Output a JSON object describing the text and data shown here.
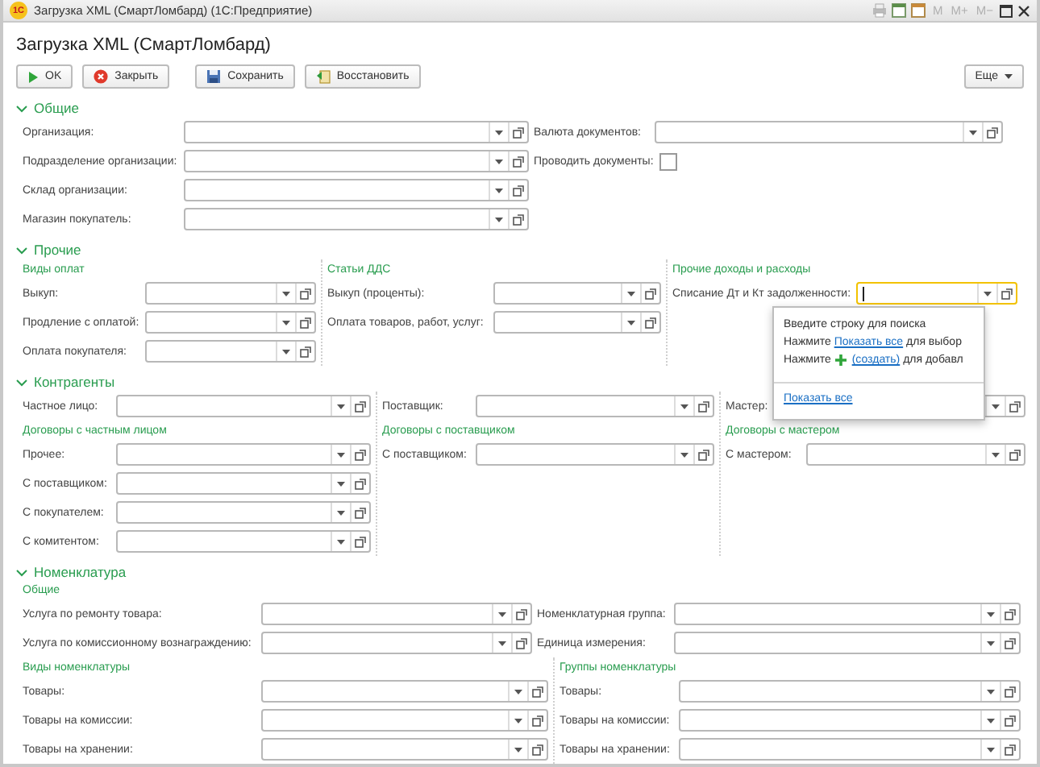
{
  "window": {
    "app_badge": "1С",
    "title": "Загрузка XML (СмартЛомбард)  (1С:Предприятие)",
    "memory_buttons": [
      "M",
      "M+",
      "M−"
    ]
  },
  "form_title": "Загрузка XML (СмартЛомбард)",
  "toolbar": {
    "buttons": [
      {
        "kind": "ok",
        "label": "OK"
      },
      {
        "kind": "close",
        "label": "Закрыть"
      },
      {
        "kind": "save",
        "label": "Сохранить"
      },
      {
        "kind": "restore",
        "label": "Восстановить"
      }
    ],
    "more": "Еще"
  },
  "sections": [
    {
      "title": "Общие",
      "expanded": true,
      "blocks": [
        {
          "columns": [
            {
              "items": [
                {
                  "kind": "select",
                  "label": "Организация:",
                  "focused": false
                },
                {
                  "kind": "select",
                  "label": "Подразделение организации:",
                  "focused": false
                },
                {
                  "kind": "select",
                  "label": "Склад организации:",
                  "focused": false
                },
                {
                  "kind": "select",
                  "label": "Магазин покупатель:",
                  "focused": false
                }
              ]
            },
            {
              "items": [
                {
                  "kind": "select",
                  "label": "Валюта документов:",
                  "focused": false
                },
                {
                  "kind": "checkbox",
                  "label": "Проводить документы:",
                  "checked": false
                }
              ]
            }
          ]
        }
      ]
    },
    {
      "title": "Прочие",
      "expanded": true,
      "blocks": [
        {
          "columns": [
            {
              "items": [
                {
                  "kind": "heading",
                  "text": "Виды оплат"
                },
                {
                  "kind": "select",
                  "label": "Выкуп:",
                  "focused": false
                },
                {
                  "kind": "select",
                  "label": "Продление с оплатой:",
                  "focused": false
                },
                {
                  "kind": "select",
                  "label": "Оплата покупателя:",
                  "focused": false
                }
              ]
            },
            {
              "items": [
                {
                  "kind": "heading",
                  "text": "Статьи ДДС"
                },
                {
                  "kind": "select",
                  "label": "Выкуп (проценты):",
                  "focused": false
                },
                {
                  "kind": "select",
                  "label": "Оплата товаров, работ, услуг:",
                  "focused": false
                }
              ]
            },
            {
              "items": [
                {
                  "kind": "heading",
                  "text": "Прочие доходы и расходы"
                },
                {
                  "kind": "select",
                  "label": "Списание Дт и Кт задолженности:",
                  "focused": true
                }
              ]
            }
          ]
        }
      ]
    },
    {
      "title": "Контрагенты",
      "expanded": true,
      "blocks": [
        {
          "columns": [
            {
              "items": [
                {
                  "kind": "select",
                  "label": "Частное лицо:",
                  "focused": false
                },
                {
                  "kind": "heading",
                  "text": "Договоры с частным лицом"
                },
                {
                  "kind": "select",
                  "label": "Прочее:",
                  "focused": false
                },
                {
                  "kind": "select",
                  "label": "С поставщиком:",
                  "focused": false
                },
                {
                  "kind": "select",
                  "label": "С покупателем:",
                  "focused": false
                },
                {
                  "kind": "select",
                  "label": "С комитентом:",
                  "focused": false
                }
              ]
            },
            {
              "items": [
                {
                  "kind": "select",
                  "label": "Поставщик:",
                  "focused": false
                },
                {
                  "kind": "heading",
                  "text": "Договоры с поставщиком"
                },
                {
                  "kind": "select",
                  "label": "С поставщиком:",
                  "focused": false
                }
              ]
            },
            {
              "items": [
                {
                  "kind": "select",
                  "label": "Мастер:",
                  "focused": false
                },
                {
                  "kind": "heading",
                  "text": "Договоры с мастером"
                },
                {
                  "kind": "select",
                  "label": "С мастером:",
                  "focused": false
                }
              ]
            }
          ]
        }
      ]
    },
    {
      "title": "Номенклатура",
      "expanded": true,
      "blocks": [
        {
          "heading": "Общие",
          "columns": [
            {
              "items": [
                {
                  "kind": "select",
                  "label": "Услуга по ремонту товара:",
                  "focused": false
                },
                {
                  "kind": "select",
                  "label": "Услуга по комиссионному вознаграждению:",
                  "focused": false
                }
              ]
            },
            {
              "items": [
                {
                  "kind": "select",
                  "label": "Номенклатурная группа:",
                  "focused": false
                },
                {
                  "kind": "select",
                  "label": "Единица измерения:",
                  "focused": false
                }
              ]
            }
          ]
        },
        {
          "columns": [
            {
              "items": [
                {
                  "kind": "heading",
                  "text": "Виды номенклатуры"
                },
                {
                  "kind": "select",
                  "label": "Товары:",
                  "focused": false
                },
                {
                  "kind": "select",
                  "label": "Товары на комиссии:",
                  "focused": false
                },
                {
                  "kind": "select",
                  "label": "Товары на хранении:",
                  "focused": false
                }
              ]
            },
            {
              "items": [
                {
                  "kind": "heading",
                  "text": "Группы номенклатуры"
                },
                {
                  "kind": "select",
                  "label": "Товары:",
                  "focused": false
                },
                {
                  "kind": "select",
                  "label": "Товары на комиссии:",
                  "focused": false
                },
                {
                  "kind": "select",
                  "label": "Товары на хранении:",
                  "focused": false
                }
              ]
            }
          ]
        }
      ]
    }
  ],
  "popup": {
    "lines": [
      [
        {
          "kind": "text",
          "text": "Введите строку для поиска"
        }
      ],
      [
        {
          "kind": "text",
          "text": "Нажмите "
        },
        {
          "kind": "link",
          "text": "Показать все"
        },
        {
          "kind": "text",
          "text": " для выбор"
        }
      ],
      [
        {
          "kind": "text",
          "text": "Нажмите "
        },
        {
          "kind": "plus"
        },
        {
          "kind": "link",
          "text": "(создать)"
        },
        {
          "kind": "text",
          "text": " для добавл"
        }
      ]
    ],
    "footer_link": "Показать все"
  }
}
